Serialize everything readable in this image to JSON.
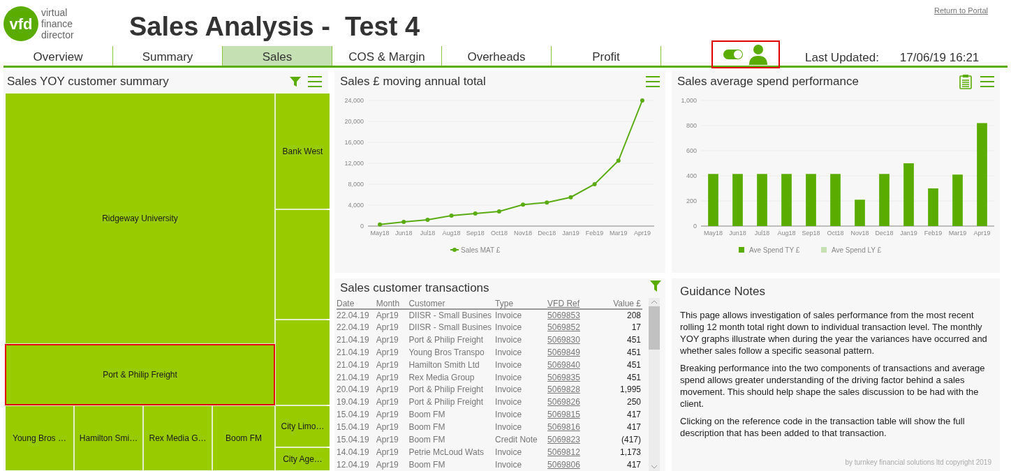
{
  "logo": {
    "mark": "vfd",
    "lines": [
      "virtual",
      "finance",
      "director"
    ]
  },
  "title": "Sales Analysis -  Test 4",
  "portal_link": "Return to Portal",
  "tabs": [
    {
      "label": "Overview",
      "selected": false
    },
    {
      "label": "Summary",
      "selected": false
    },
    {
      "label": "Sales",
      "selected": true
    },
    {
      "label": "COS & Margin",
      "selected": false
    },
    {
      "label": "Overheads",
      "selected": false
    },
    {
      "label": "Profit",
      "selected": false
    }
  ],
  "toggle": {
    "on": true
  },
  "last_updated": {
    "label": "Last Updated:",
    "value": "17/06/19 16:21"
  },
  "treemap_panel": {
    "title": "Sales YOY customer summary",
    "cells": [
      {
        "label": "Ridgeway University",
        "selected": false
      },
      {
        "label": "Port & Philip Freight",
        "selected": true
      },
      {
        "label": "Bank West",
        "selected": false
      },
      {
        "label": "Young Bros …",
        "selected": false
      },
      {
        "label": "Hamilton Smi…",
        "selected": false
      },
      {
        "label": "Rex Media G…",
        "selected": false
      },
      {
        "label": "Boom FM",
        "selected": false
      },
      {
        "label": "City Limo…",
        "selected": false
      },
      {
        "label": "City Age…",
        "selected": false
      }
    ]
  },
  "mat_panel": {
    "title": "Sales £ moving annual total",
    "chart_data": {
      "type": "line",
      "categories": [
        "May18",
        "Jun18",
        "Jul18",
        "Aug18",
        "Sep18",
        "Oct18",
        "Nov18",
        "Dec18",
        "Jan19",
        "Feb19",
        "Mar19",
        "Apr19"
      ],
      "series": [
        {
          "name": "Sales MAT £",
          "color": "#5aac12",
          "marker": "circle",
          "values": [
            300,
            800,
            1200,
            2000,
            2400,
            2800,
            4100,
            4500,
            5500,
            8000,
            12500,
            24000
          ]
        }
      ],
      "grid": true,
      "ylim": [
        0,
        24000
      ],
      "yticks": [
        {
          "value": 0,
          "label": "0"
        },
        {
          "value": 4000,
          "label": "4,000"
        },
        {
          "value": 8000,
          "label": "8,000"
        },
        {
          "value": 12000,
          "label": "12,000"
        },
        {
          "value": 16000,
          "label": "16,000"
        },
        {
          "value": 20000,
          "label": "20,000"
        },
        {
          "value": 24000,
          "label": "24,000"
        }
      ]
    }
  },
  "spend_panel": {
    "title": "Sales average spend performance",
    "chart_data": {
      "type": "bar",
      "categories": [
        "May18",
        "Jun18",
        "Jul18",
        "Aug18",
        "Sep18",
        "Oct18",
        "Nov18",
        "Dec18",
        "Jan19",
        "Feb19",
        "Mar19",
        "Apr19"
      ],
      "series": [
        {
          "name": "Ave Spend TY £",
          "color": "#5aac00",
          "values": [
            415,
            415,
            415,
            415,
            415,
            415,
            210,
            415,
            500,
            300,
            410,
            820
          ]
        },
        {
          "name": "Ave Spend LY £",
          "color": "#c5e0b3",
          "values": [
            null,
            null,
            null,
            null,
            null,
            null,
            null,
            null,
            null,
            null,
            null,
            null
          ]
        }
      ],
      "grid": true,
      "ylim": [
        0,
        1000
      ],
      "yticks": [
        {
          "value": 0,
          "label": "0"
        },
        {
          "value": 200,
          "label": "200"
        },
        {
          "value": 400,
          "label": "400"
        },
        {
          "value": 600,
          "label": "600"
        },
        {
          "value": 800,
          "label": "800"
        },
        {
          "value": 1000,
          "label": "1,000"
        }
      ]
    }
  },
  "transactions": {
    "title": "Sales customer transactions",
    "columns": [
      "Date",
      "Month",
      "Customer",
      "Type",
      "VFD Ref",
      "Value £"
    ],
    "rows": [
      [
        "22.04.19",
        "Apr19",
        "DIISR - Small Busines",
        "Invoice",
        "5069853",
        "208"
      ],
      [
        "22.04.19",
        "Apr19",
        "DIISR - Small Busines",
        "Invoice",
        "5069852",
        "17"
      ],
      [
        "21.04.19",
        "Apr19",
        "Port & Philip Freight",
        "Invoice",
        "5069830",
        "451"
      ],
      [
        "21.04.19",
        "Apr19",
        "Young Bros Transpo",
        "Invoice",
        "5069849",
        "451"
      ],
      [
        "21.04.19",
        "Apr19",
        "Hamilton Smith Ltd",
        "Invoice",
        "5069840",
        "451"
      ],
      [
        "21.04.19",
        "Apr19",
        "Rex Media Group",
        "Invoice",
        "5069835",
        "451"
      ],
      [
        "20.04.19",
        "Apr19",
        "Port & Philip Freight",
        "Invoice",
        "5069828",
        "1,995"
      ],
      [
        "19.04.19",
        "Apr19",
        "Port & Philip Freight",
        "Invoice",
        "5069826",
        "250"
      ],
      [
        "15.04.19",
        "Apr19",
        "Boom FM",
        "Invoice",
        "5069815",
        "417"
      ],
      [
        "15.04.19",
        "Apr19",
        "Boom FM",
        "Invoice",
        "5069816",
        "417"
      ],
      [
        "15.04.19",
        "Apr19",
        "Boom FM",
        "Credit Note",
        "5069823",
        "(417)"
      ],
      [
        "14.04.19",
        "Apr19",
        "Petrie McLoud Wats",
        "Invoice",
        "5069812",
        "1,173"
      ],
      [
        "12.04.19",
        "Apr19",
        "Boom FM",
        "Invoice",
        "5069806",
        "417"
      ]
    ]
  },
  "guidance": {
    "title": "Guidance Notes",
    "paragraphs": [
      "This page allows investigation of sales performance from the most recent rolling 12 month total right down to individual transaction level. The monthly YOY graphs illustrate when during the year the variances have occurred and whether sales follow a specific seasonal pattern.",
      "Breaking performance into the two components of transactions and average spend allows greater understanding of the driving factor behind a sales movement.  This should help shape the sales discussion to be had with the client.",
      "Clicking on the reference code in the transaction table will show the full description that has been added to that transaction."
    ],
    "footer": "by turnkey financial solutions ltd copyright 2019"
  }
}
